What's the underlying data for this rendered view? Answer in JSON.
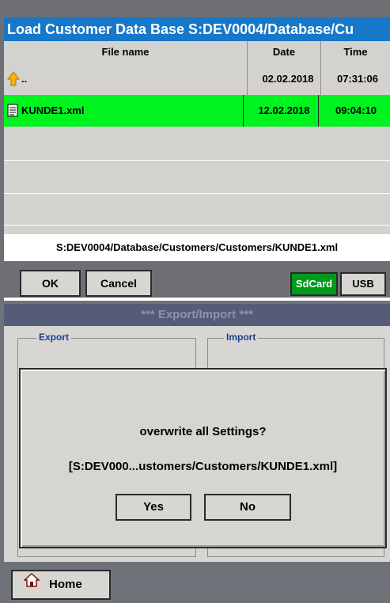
{
  "file_dialog": {
    "title": "Load Customer Data Base S:DEV0004/Database/Cu",
    "columns": {
      "name": "File name",
      "date": "Date",
      "time": "Time"
    },
    "rows": [
      {
        "icon": "folder-up-icon",
        "name": "..",
        "date": "02.02.2018",
        "time": "07:31:06",
        "selected": false
      },
      {
        "icon": "xml-file-icon",
        "name": "KUNDE1.xml",
        "date": "12.02.2018",
        "time": "09:04:10",
        "selected": true
      }
    ],
    "path": "S:DEV0004/Database/Customers/Customers/KUNDE1.xml",
    "ok_label": "OK",
    "cancel_label": "Cancel",
    "sdcard_label": "SdCard",
    "usb_label": "USB"
  },
  "export_import": {
    "title": "***   Export/Import   ***",
    "export_label": "Export",
    "import_label": "Import"
  },
  "confirm_dialog": {
    "question": "overwrite all Settings?",
    "path": "[S:DEV000...ustomers/Customers/KUNDE1.xml]",
    "yes_label": "Yes",
    "no_label": "No"
  },
  "home": {
    "label": "Home",
    "icon": "home-icon"
  },
  "colors": {
    "title_bar": "#1777c9",
    "selected_row": "#00f21f",
    "sdcard_active": "#009a1a",
    "panel_bg": "#d8d6d2"
  }
}
